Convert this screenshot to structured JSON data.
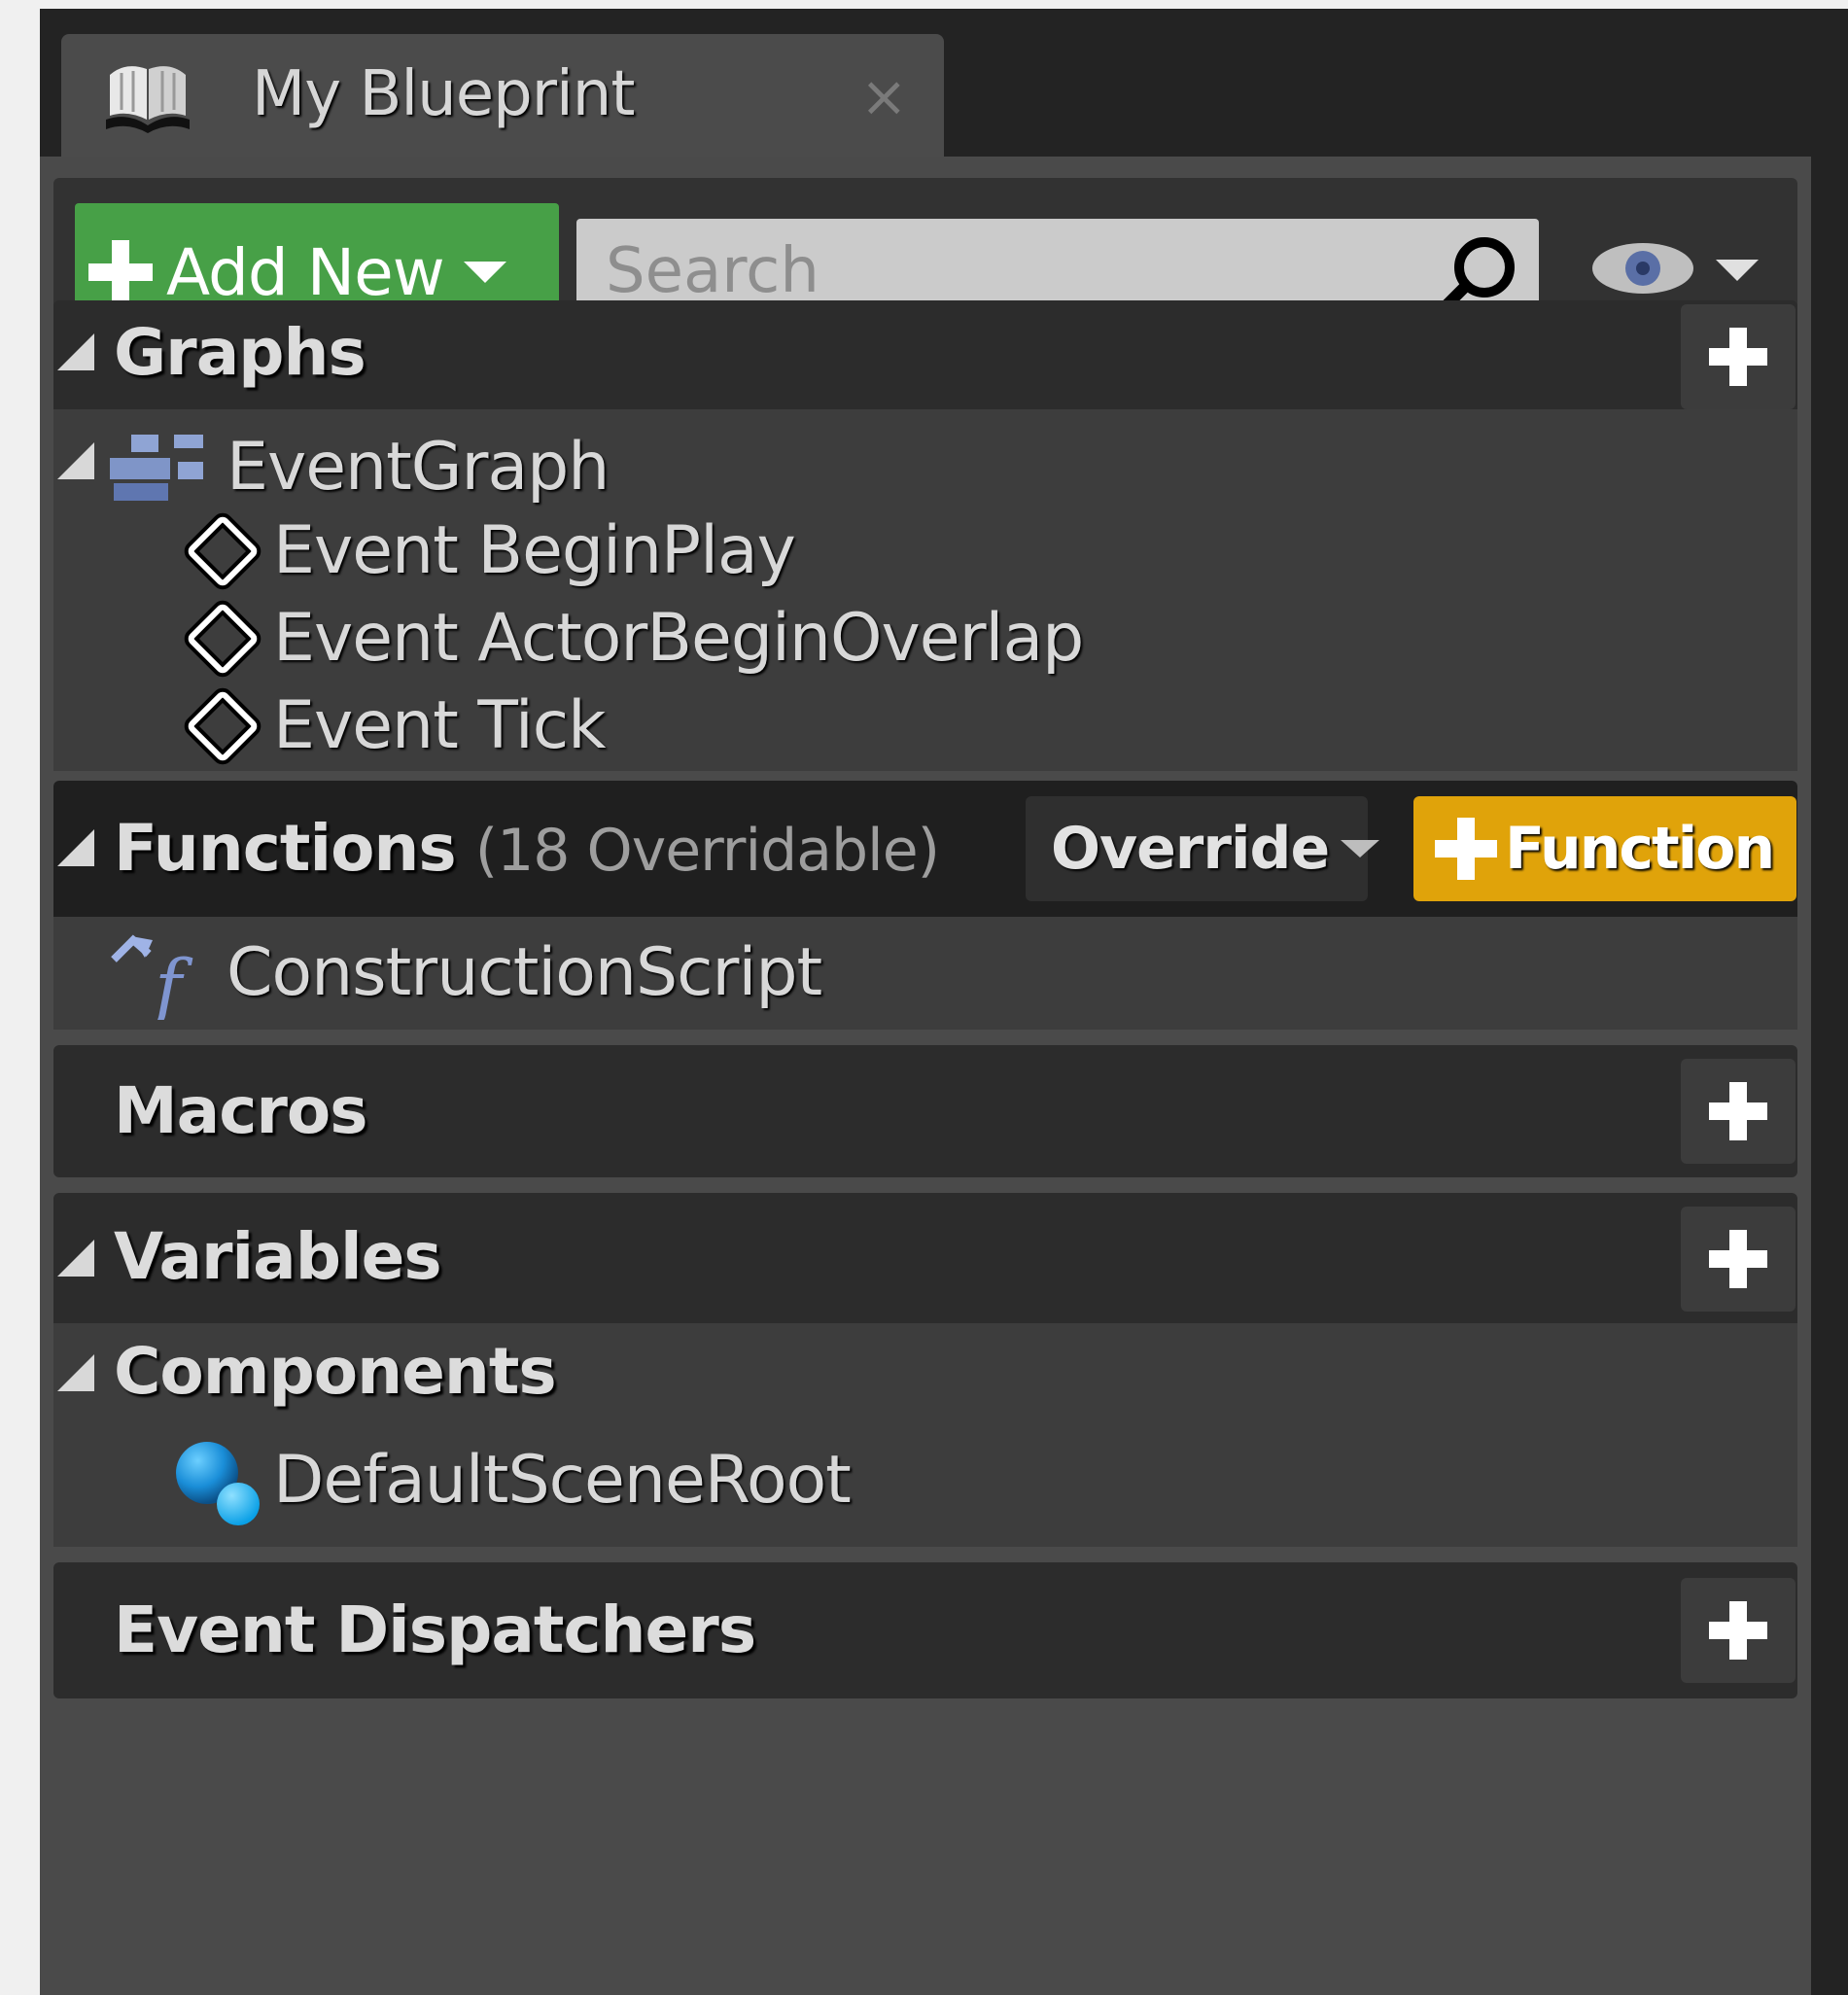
{
  "tab": {
    "title": "My Blueprint",
    "close": "×"
  },
  "toolbar": {
    "add_new_label": "Add New",
    "search_placeholder": "Search",
    "colors": {
      "add_new": "#47a047"
    }
  },
  "graphs": {
    "title": "Graphs",
    "event_graph": "EventGraph",
    "events": [
      "Event BeginPlay",
      "Event ActorBeginOverlap",
      "Event Tick"
    ]
  },
  "functions": {
    "title": "Functions",
    "overridable": "(18 Overridable)",
    "override_label": "Override",
    "function_label": "Function",
    "items": [
      "ConstructionScript"
    ],
    "colors": {
      "function_button": "#e0a30a"
    }
  },
  "macros": {
    "title": "Macros"
  },
  "variables": {
    "title": "Variables",
    "components_title": "Components",
    "components": [
      "DefaultSceneRoot"
    ]
  },
  "event_dispatchers": {
    "title": "Event Dispatchers"
  },
  "icons": {
    "tab": "book-icon",
    "search": "magnifier-icon",
    "visibility": "eye-icon",
    "event": "event-diamond-icon",
    "graph": "event-graph-icon",
    "function": "function-icon",
    "component": "scene-component-icon"
  }
}
